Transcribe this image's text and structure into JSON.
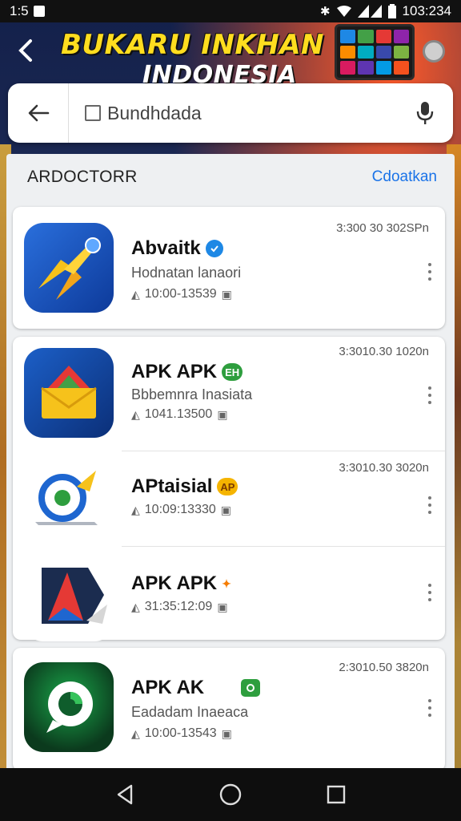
{
  "status_bar": {
    "time_left": "1:5",
    "time_right": "103:234"
  },
  "header": {
    "title": "BUKARU INKHAN",
    "subtitle": "INDONESIA"
  },
  "search": {
    "value": "Bundhdada"
  },
  "section": {
    "title": "ARDOCTORR",
    "link": "Cdoatkan"
  },
  "apps": [
    {
      "name": "Abvaitk",
      "subtitle": "Hodnatan lanaori",
      "meta": "10:00-13539",
      "time": "3:300 30 302SPn",
      "badge": "",
      "badge_color": "#1e88e5"
    },
    {
      "name": "APK APK",
      "subtitle": "Bbbemnra Inasiata",
      "meta": "1041.13500",
      "time": "3:3010.30 1020n",
      "badge": "EH",
      "badge_color": "#2e9e3e"
    },
    {
      "name": "APtaisial",
      "subtitle": "",
      "meta": "10:09:13330",
      "time": "3:3010.30 3020n",
      "badge": "AP",
      "badge_color": "#f5b400"
    },
    {
      "name": "APK APK",
      "subtitle": "",
      "meta": "31:35:12:09",
      "time": "",
      "badge": "",
      "badge_color": "#f57c00"
    },
    {
      "name": "APK AK",
      "subtitle": "Eadadam Inaeaca",
      "meta": "10:00-13543",
      "time": "2:3010.50 3820n",
      "badge": "",
      "badge_color": "#2e9e3e"
    }
  ],
  "colors": {
    "accent_link": "#1a73e8",
    "banner_yellow": "#ffdd1f",
    "nav_background": "#0e0e0e"
  },
  "icons": {
    "status_left": "notification-box-icon",
    "status_right": [
      "bluetooth-icon",
      "wifi-icon",
      "signal-icon",
      "battery-icon"
    ],
    "search_back": "arrow-left-icon",
    "search_mic": "microphone-icon",
    "nav": [
      "back-triangle-icon",
      "home-circle-icon",
      "recents-square-icon"
    ]
  }
}
